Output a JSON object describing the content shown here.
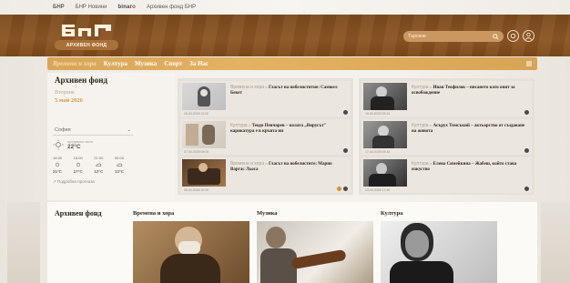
{
  "topbar": {
    "links": [
      "БНР",
      "БНР Новини"
    ],
    "binaro_prefix": "binar",
    "binaro_suffix": "o",
    "extra": "Архивен фонд БНР"
  },
  "header": {
    "logo_text": "АРХИВЕН ФОНД",
    "search_placeholder": "Търсене"
  },
  "nav": {
    "items": [
      "Времена и хора",
      "Култура",
      "Музика",
      "Спорт",
      "За Нас"
    ]
  },
  "left": {
    "title": "Архивен фонд",
    "weekday": "Вторник",
    "date": "5 май 2026",
    "weather": {
      "city": "София",
      "condition": "предимно ясно",
      "temp": "22°C",
      "forecast": [
        {
          "time": "18:00",
          "temp": "21°C"
        },
        {
          "time": "18:00",
          "temp": "17°C"
        },
        {
          "time": "21:00",
          "temp": "12°C"
        },
        {
          "time": "00:00",
          "temp": "13°C"
        }
      ],
      "link": "Подробна прогноза"
    }
  },
  "cards_left": [
    {
      "cat": "Времена и хора",
      "title": "Гласът на нобелиститие: Самюел Бекет",
      "meta": "16.04.2025 10:00"
    },
    {
      "cat": "Култура",
      "title": "Теодо Пенчарев – колата „Вирусът\" карикатура е в кръвта ни",
      "meta": "07.04.2025 09:00"
    },
    {
      "cat": "Времена и хора",
      "title": "Гласът на нобелистите: Марио Варгас Льоса",
      "meta": "06.04.2025 10:00"
    }
  ],
  "cards_right": [
    {
      "cat": "Култура",
      "title": "Иван Теофилов – писането като опит за освобождение",
      "meta": "19.04.2025 09:13"
    },
    {
      "cat": "Култура",
      "title": "Асърух Томсъкий – актьорство от създаване на живота",
      "meta": "17.04.2025 09:43"
    },
    {
      "cat": "Култура",
      "title": "Елена Симейкина – Жабеш, който става изкуство",
      "meta": "13.04.2025 17:30"
    }
  ],
  "bottom": {
    "title": "Архивен фонд",
    "categories": [
      "Времена и хора",
      "Музика",
      "Култура"
    ]
  },
  "colors": {
    "brown": "#7a4a1e",
    "gold": "#e3b262",
    "accent": "#d49a3e"
  }
}
